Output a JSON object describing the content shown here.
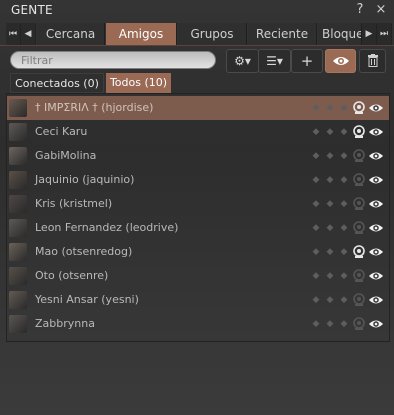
{
  "window": {
    "title": "GENTE",
    "controls": [
      "help-icon",
      "close-icon"
    ]
  },
  "tabs": [
    {
      "label": "Cercana",
      "active": false
    },
    {
      "label": "Amigos",
      "active": true
    },
    {
      "label": "Grupos",
      "active": false
    },
    {
      "label": "Reciente",
      "active": false
    },
    {
      "label": "Bloque",
      "active": false
    }
  ],
  "toolbar": {
    "filter_placeholder": "Filtrar",
    "buttons": [
      "gear-menu-icon",
      "list-view-menu-icon",
      "add-icon",
      "eye-icon",
      "trash-icon"
    ]
  },
  "subtabs": [
    {
      "label": "Conectados (0)",
      "active": false
    },
    {
      "label": "Todos (10)",
      "active": true
    }
  ],
  "friends": [
    {
      "name": "† ΙΜΡΣRIΛ † (hjordise)",
      "selected": true,
      "map_rights": true,
      "visible": true
    },
    {
      "name": "Ceci Karu",
      "selected": false,
      "map_rights": true,
      "visible": true
    },
    {
      "name": "GabiMolina",
      "selected": false,
      "map_rights": false,
      "visible": true
    },
    {
      "name": "Jaquinio (jaquinio)",
      "selected": false,
      "map_rights": false,
      "visible": true
    },
    {
      "name": "Kris (kristmel)",
      "selected": false,
      "map_rights": false,
      "visible": true
    },
    {
      "name": "Leon Fernandez (leodrive)",
      "selected": false,
      "map_rights": false,
      "visible": true
    },
    {
      "name": "Mao (otsenredog)",
      "selected": false,
      "map_rights": true,
      "visible": true
    },
    {
      "name": "Oto (otsenre)",
      "selected": false,
      "map_rights": false,
      "visible": true
    },
    {
      "name": "Yesni Ansar (yesni)",
      "selected": false,
      "map_rights": false,
      "visible": true
    },
    {
      "name": "Zabbrynna",
      "selected": false,
      "map_rights": false,
      "visible": true
    }
  ],
  "colors": {
    "accent": "#9b6a55",
    "selected_row": "#7d5c4d",
    "background": "#333333"
  }
}
